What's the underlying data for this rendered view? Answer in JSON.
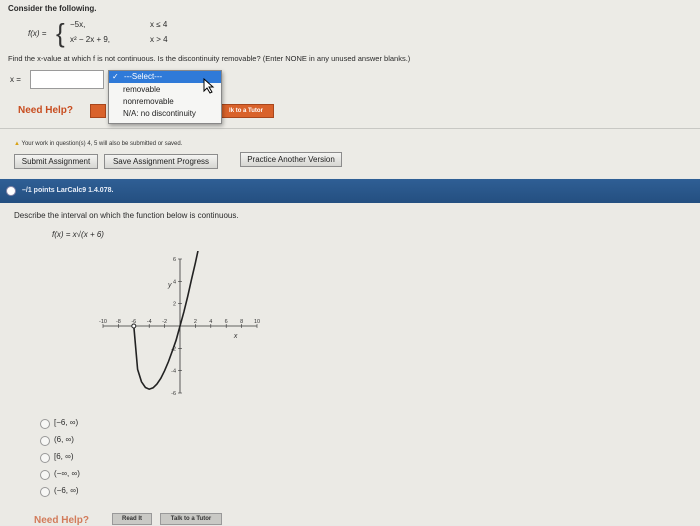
{
  "q1": {
    "prompt": "Consider the following.",
    "func_name": "f(x) =",
    "piece1_expr": "−5x,",
    "piece1_cond": "x ≤ 4",
    "piece2_expr": "x² − 2x + 9,",
    "piece2_cond": "x > 4",
    "instruction": "Find the x-value at which f is not continuous. Is the discontinuity removable? (Enter NONE in any unused answer blanks.)",
    "x_label": "x =",
    "x_value": "",
    "dropdown": {
      "selected": "---Select---",
      "options": [
        "removable",
        "nonremovable",
        "N/A: no discontinuity"
      ]
    },
    "need_help": "Need Help?",
    "talk_to_tutor": "lk to a Tutor",
    "warning": "Your work in question(s) 4, 5 will also be submitted or saved.",
    "buttons": {
      "submit": "Submit Assignment",
      "save": "Save Assignment Progress",
      "practice": "Practice Another Version"
    }
  },
  "q2": {
    "header": "–/1 points  LarCalc9 1.4.078.",
    "prompt": "Describe the interval on which the function below is continuous.",
    "function": "f(x) = x√(x + 6)",
    "choices": [
      "[−6, ∞)",
      "(6, ∞)",
      "[6, ∞)",
      "(−∞, ∞)",
      "(−6, ∞)"
    ],
    "need_help": "Need Help?",
    "read_it": "Read It",
    "talk_to_tutor": "Talk to a Tutor"
  },
  "chart_data": {
    "type": "line",
    "title": "",
    "xlabel": "x",
    "ylabel": "y",
    "xlim": [
      -10,
      10
    ],
    "ylim": [
      -6,
      6
    ],
    "x_ticks": [
      -10,
      -8,
      -6,
      -4,
      -2,
      0,
      2,
      4,
      6,
      8,
      10
    ],
    "y_ticks": [
      6,
      4,
      2,
      -2,
      -4,
      -6
    ],
    "grid": false,
    "series": [
      {
        "x": [
          -6,
          -5.5,
          -5,
          -4.5,
          -4,
          -3.5,
          -3,
          -2.5,
          -2,
          -1.5,
          -1,
          -0.5,
          0,
          0.5,
          1,
          1.5,
          2,
          2.5,
          3
        ],
        "values": [
          0,
          -3.89,
          -5,
          -5.51,
          -5.66,
          -5.53,
          -5.2,
          -4.68,
          -4,
          -3.18,
          -2.24,
          -1.27,
          0,
          1.27,
          2.65,
          4.17,
          5.66,
          7.29,
          9
        ]
      }
    ],
    "accent_color": "#2f5f95"
  }
}
